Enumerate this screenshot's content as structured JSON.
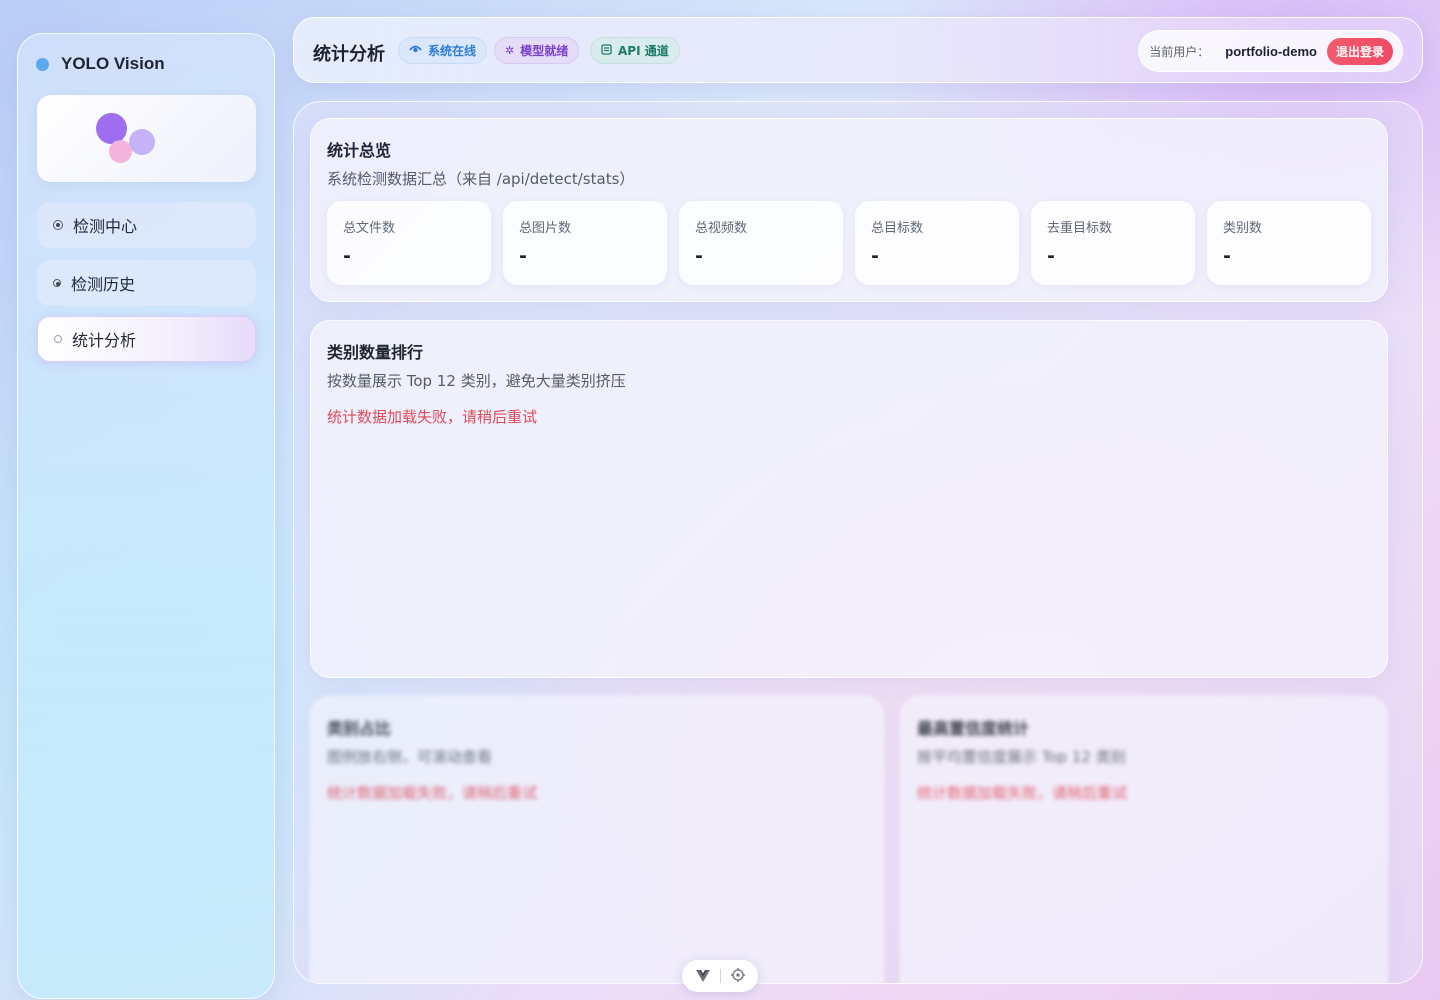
{
  "brand": {
    "name": "YOLO Vision",
    "dot_color": "#5aa9f0"
  },
  "sidebar": {
    "items": [
      {
        "label": "检测中心",
        "icon": "radio-filled-icon",
        "active": false
      },
      {
        "label": "检测历史",
        "icon": "radio-small-icon",
        "active": false
      },
      {
        "label": "统计分析",
        "icon": "radio-empty-icon",
        "active": true
      }
    ]
  },
  "header": {
    "title": "统计分析",
    "badges": [
      {
        "label": "系统在线",
        "icon": "eye-icon",
        "color": "#2f7bd8"
      },
      {
        "label": "模型就绪",
        "icon": "gear-icon",
        "color": "#7b3fd0"
      },
      {
        "label": "API 通道",
        "icon": "document-icon",
        "color": "#1f7a6a"
      }
    ],
    "user_label": "当前用户：",
    "user_name": "portfolio-demo",
    "logout_label": "退出登录",
    "logout_color": "#ef4a64"
  },
  "overview": {
    "title": "统计总览",
    "subtitle": "系统检测数据汇总（来自 /api/detect/stats）",
    "cards": [
      {
        "label": "总文件数",
        "value": "-"
      },
      {
        "label": "总图片数",
        "value": "-"
      },
      {
        "label": "总视频数",
        "value": "-"
      },
      {
        "label": "总目标数",
        "value": "-"
      },
      {
        "label": "去重目标数",
        "value": "-"
      },
      {
        "label": "类别数",
        "value": "-"
      }
    ]
  },
  "ranking": {
    "title": "类别数量排行",
    "subtitle": "按数量展示 Top 12 类别，避免大量类别挤压",
    "error": "统计数据加载失败，请稍后重试"
  },
  "ratio": {
    "title": "类别占比",
    "subtitle": "图例放右侧，可滚动查看",
    "error": "统计数据加载失败，请稍后重试"
  },
  "confidence": {
    "title": "最高置信度统计",
    "subtitle": "按平均置信度展示 Top 12 类别",
    "error": "统计数据加载失败，请稍后重试"
  },
  "devtools": {
    "icons": [
      "vue-logo-icon",
      "crosshair-icon"
    ]
  }
}
